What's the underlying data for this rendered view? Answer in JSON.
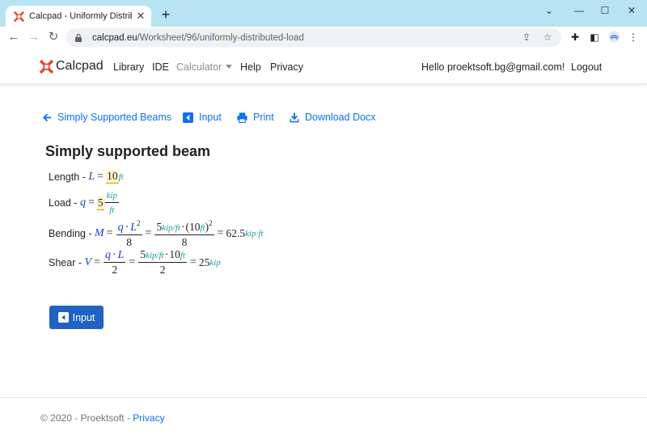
{
  "browser": {
    "tab_title": "Calcpad - Uniformly Distributed Load",
    "url_domain": "calcpad.eu",
    "url_path": "/Worksheet/96/uniformly-distributed-load"
  },
  "site": {
    "brand": "Calcpad",
    "nav": {
      "library": "Library",
      "ide": "IDE",
      "calculator": "Calculator",
      "help": "Help",
      "privacy": "Privacy",
      "greeting": "Hello proektsoft.bg@gmail.com!",
      "logout": "Logout"
    }
  },
  "actions": {
    "back_label": "Simply Supported Beams",
    "input_label": "Input",
    "print_label": "Print",
    "download_label": "Download Docx"
  },
  "worksheet": {
    "title": "Simply supported beam",
    "length": {
      "label": "Length -",
      "var": "L",
      "value": "10",
      "unit": "ft"
    },
    "load": {
      "label": "Load -",
      "var": "q",
      "value": "5",
      "unit_num": "kip",
      "unit_den": "ft"
    },
    "bending": {
      "label": "Bending -",
      "var": "M",
      "f1_num_a": "q",
      "f1_num_b": "L",
      "f1_exp": "2",
      "f1_den": "8",
      "f2_num_val": "5",
      "f2_num_unit": "kip/ft",
      "f2_num_val2": "(10",
      "f2_num_unit2": "ft",
      "f2_num_close": ")",
      "f2_exp": "2",
      "f2_den": "8",
      "result": "62.5",
      "result_unit": "kip·ft"
    },
    "shear": {
      "label": "Shear -",
      "var": "V",
      "f1_num_a": "q",
      "f1_num_b": "L",
      "f1_den": "2",
      "f2_num_val": "5",
      "f2_num_unit": "kip/ft",
      "f2_num_val2": "10",
      "f2_num_unit2": "ft",
      "f2_den": "2",
      "result": "25",
      "result_unit": "kip"
    }
  },
  "input_button": "Input",
  "footer": {
    "copyright": "© 2020 - Proektsoft - ",
    "privacy": "Privacy"
  },
  "colors": {
    "link": "#0d6efd",
    "button": "#1f63c4",
    "variable": "#1a3ccc",
    "unit": "#1a9a9a",
    "titlebar": "#b7e3f2"
  }
}
